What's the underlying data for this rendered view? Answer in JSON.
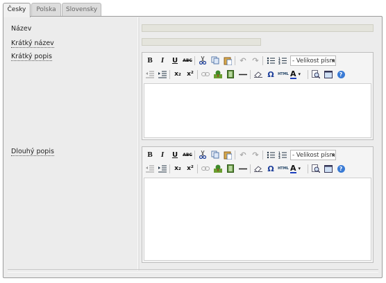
{
  "tabs": [
    {
      "label": "Česky",
      "active": true
    },
    {
      "label": "Polska",
      "active": false
    },
    {
      "label": "Slovensky",
      "active": false
    }
  ],
  "fields": {
    "nazev": {
      "label": "Název",
      "value": ""
    },
    "kratky_nazev": {
      "label": "Krátký název",
      "value": ""
    },
    "kratky_popis": {
      "label": "Krátký popis"
    },
    "dlouhy_popis": {
      "label": "Dlouhý popis"
    }
  },
  "editor": {
    "font_size_select": "- Velikost písma",
    "buttons_row1": [
      "bold-icon",
      "italic-icon",
      "underline-icon",
      "strikethrough-icon",
      "cut-icon",
      "copy-icon",
      "paste-icon",
      "undo-icon",
      "redo-icon",
      "bullet-list-icon",
      "numbered-list-icon"
    ],
    "buttons_row2": [
      "outdent-icon",
      "indent-icon",
      "subscript-icon",
      "superscript-icon",
      "link-icon",
      "image-icon",
      "media-icon",
      "horizontal-rule-icon",
      "eraser-icon",
      "special-char-icon",
      "html-icon",
      "font-color-icon",
      "preview-icon",
      "fullscreen-icon",
      "help-icon"
    ],
    "labels": {
      "bold": "B",
      "italic": "I",
      "underline": "U",
      "strike": "ABC",
      "sub": "x₂",
      "sup": "x²",
      "omega": "Ω",
      "html": "HTML",
      "fontcolor": "A",
      "help": "?"
    }
  },
  "colors": {
    "panel_bg": "#ececec",
    "input_bg": "#e4e4dc",
    "help_blue": "#3a7bd5",
    "font_color_underline": "#1c3fbf"
  }
}
